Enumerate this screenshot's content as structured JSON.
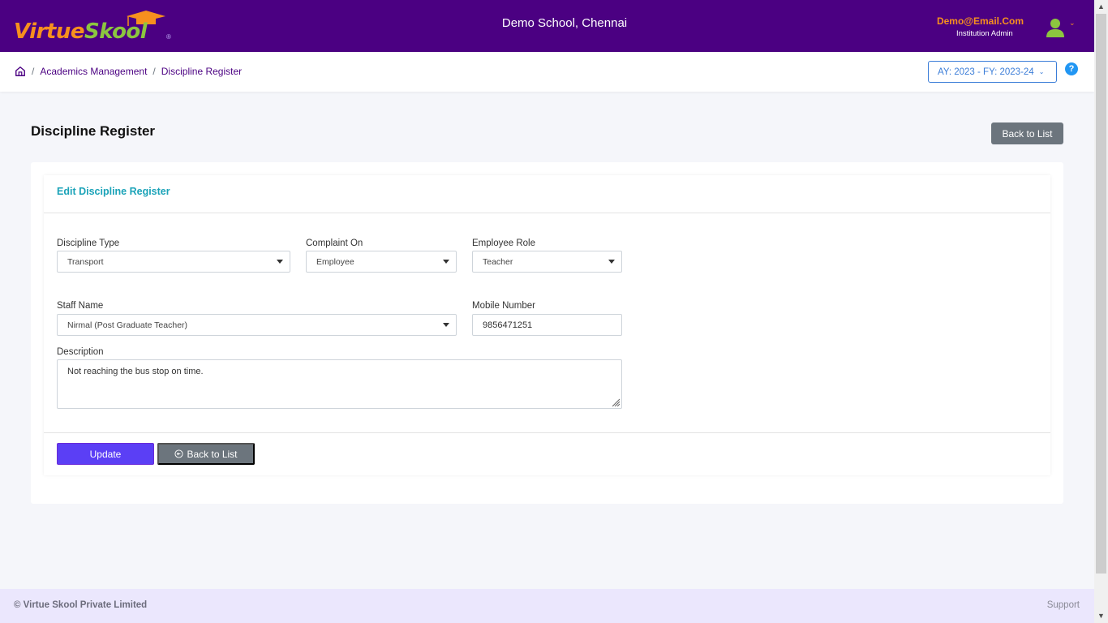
{
  "header": {
    "logo": {
      "part1": "Virtue",
      "part2": "Skool",
      "reg": "®"
    },
    "school_name": "Demo School, Chennai",
    "user": {
      "email": "Demo@Email.Com",
      "role": "Institution Admin"
    },
    "colors": {
      "brand_purple": "#4b0082",
      "brand_orange": "#f7901e",
      "brand_green": "#8cc63f"
    }
  },
  "subbar": {
    "breadcrumb": [
      "Academics Management",
      "Discipline Register"
    ],
    "year_selector": "AY: 2023 - FY: 2023-24",
    "help": "?"
  },
  "page": {
    "title": "Discipline Register",
    "back_to_list_top": "Back to List"
  },
  "form": {
    "header": "Edit Discipline Register",
    "fields": {
      "discipline_type": {
        "label": "Discipline Type",
        "value": "Transport"
      },
      "complaint_on": {
        "label": "Complaint On",
        "value": "Employee"
      },
      "employee_role": {
        "label": "Employee Role",
        "value": "Teacher"
      },
      "staff_name": {
        "label": "Staff Name",
        "value": "Nirmal (Post Graduate Teacher)"
      },
      "mobile_number": {
        "label": "Mobile Number",
        "value": "9856471251"
      },
      "description": {
        "label": "Description",
        "value": "Not reaching the bus stop on time."
      }
    },
    "buttons": {
      "update": "Update",
      "back_to_list": "Back to List"
    },
    "colors": {
      "update_bg": "#5b3ff5",
      "secondary_bg": "#6c757d",
      "header_text": "#1ba3b8"
    }
  },
  "footer": {
    "copyright": "© Virtue Skool Private Limited",
    "support": "Support"
  }
}
